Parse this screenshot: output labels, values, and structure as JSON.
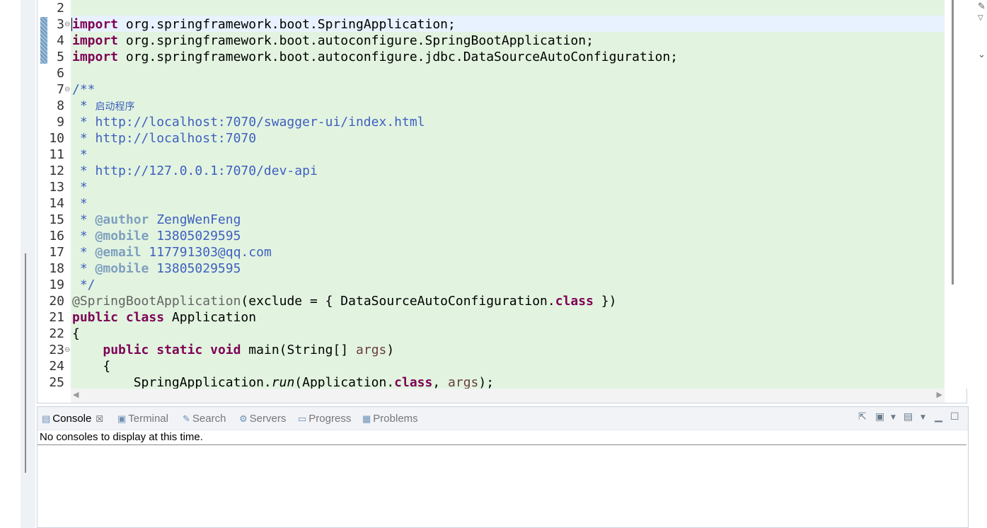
{
  "editor": {
    "lines": [
      {
        "num": "2",
        "fold": "",
        "html": ""
      },
      {
        "num": "3",
        "fold": "⊖",
        "html": "<span class=\"kw\">import</span> org.springframework.boot.SpringApplication;"
      },
      {
        "num": "4",
        "fold": "",
        "html": "<span class=\"kw\">import</span> org.springframework.boot.autoconfigure.SpringBootApplication;"
      },
      {
        "num": "5",
        "fold": "",
        "html": "<span class=\"kw\">import</span> org.springframework.boot.autoconfigure.jdbc.DataSourceAutoConfiguration;"
      },
      {
        "num": "6",
        "fold": "",
        "html": ""
      },
      {
        "num": "7",
        "fold": "⊖",
        "html": "<span class=\"cm\">/**</span>"
      },
      {
        "num": "8",
        "fold": "",
        "html": "<span class=\"cm\"> * <span class=\"cjk\">启动程序</span></span>"
      },
      {
        "num": "9",
        "fold": "",
        "html": "<span class=\"cm\"> * http://localhost:7070/swagger-ui/index.html</span>"
      },
      {
        "num": "10",
        "fold": "",
        "html": "<span class=\"cm\"> * http://localhost:7070</span>"
      },
      {
        "num": "11",
        "fold": "",
        "html": "<span class=\"cm\"> *</span>"
      },
      {
        "num": "12",
        "fold": "",
        "html": "<span class=\"cm\"> * http://127.0.0.1:7070/dev-api</span>"
      },
      {
        "num": "13",
        "fold": "",
        "html": "<span class=\"cm\"> *</span>"
      },
      {
        "num": "14",
        "fold": "",
        "html": "<span class=\"cm\"> *</span>"
      },
      {
        "num": "15",
        "fold": "",
        "html": "<span class=\"cm\"> * <span class=\"tag\">@author</span> ZengWenFeng</span>"
      },
      {
        "num": "16",
        "fold": "",
        "html": "<span class=\"cm\"> * <span class=\"tag\">@mobile</span> 13805029595</span>"
      },
      {
        "num": "17",
        "fold": "",
        "html": "<span class=\"cm\"> * <span class=\"tag\">@email</span> 117791303@qq.com</span>"
      },
      {
        "num": "18",
        "fold": "",
        "html": "<span class=\"cm\"> * <span class=\"tag\">@mobile</span> 13805029595</span>"
      },
      {
        "num": "19",
        "fold": "",
        "html": "<span class=\"cm\"> */</span>"
      },
      {
        "num": "20",
        "fold": "",
        "html": "<span class=\"ann\">@SpringBootApplication</span>(exclude = { DataSourceAutoConfiguration.<span class=\"kw\">class</span> })"
      },
      {
        "num": "21",
        "fold": "",
        "html": "<span class=\"kw\">public</span> <span class=\"kw\">class</span> Application"
      },
      {
        "num": "22",
        "fold": "",
        "html": "{"
      },
      {
        "num": "23",
        "fold": "⊖",
        "html": "    <span class=\"kw\">public</span> <span class=\"kw\">static</span> <span class=\"kw\">void</span> main(String[] <span class=\"param\">args</span>)"
      },
      {
        "num": "24",
        "fold": "",
        "html": "    {"
      },
      {
        "num": "25",
        "fold": "",
        "html": "        SpringApplication.<span class=\"ital\">run</span>(Application.<span class=\"kw\">class</span>, <span class=\"param\">args</span>);"
      }
    ]
  },
  "console": {
    "tabs": [
      {
        "label": "Console",
        "icon": "console-icon",
        "glyph": "▤",
        "active": true
      },
      {
        "label": "Terminal",
        "icon": "terminal-icon",
        "glyph": "▣",
        "active": false
      },
      {
        "label": "Search",
        "icon": "search-icon",
        "glyph": "✎",
        "active": false
      },
      {
        "label": "Servers",
        "icon": "servers-icon",
        "glyph": "⚙",
        "active": false
      },
      {
        "label": "Progress",
        "icon": "progress-icon",
        "glyph": "▭",
        "active": false
      },
      {
        "label": "Problems",
        "icon": "problems-icon",
        "glyph": "▦",
        "active": false
      }
    ],
    "close_glyph": "☒",
    "message": "No consoles to display at this time."
  },
  "colors": {
    "code_background": "#e2f4e0",
    "current_line": "#e8f2fe",
    "keyword": "#7f0055",
    "comment": "#3f5fbf",
    "javadoc_tag": "#7f9fbf"
  }
}
